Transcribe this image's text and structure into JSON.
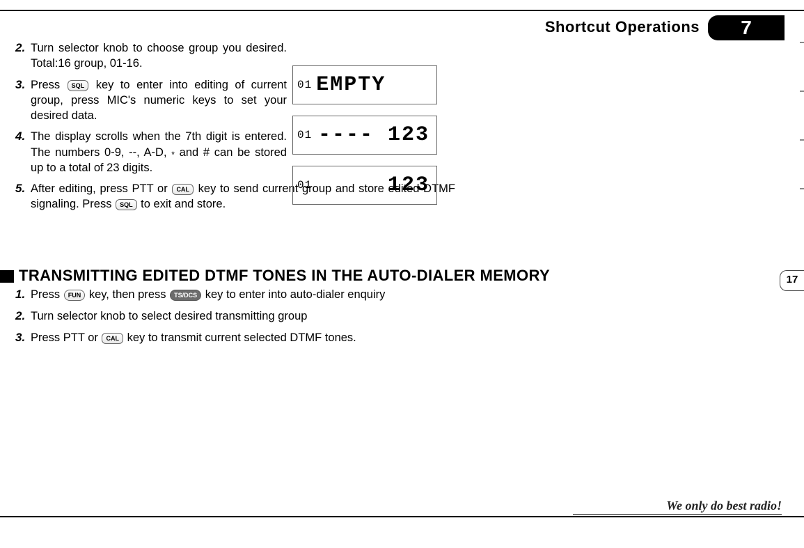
{
  "header": {
    "title": "Shortcut Operations",
    "chapter": "7"
  },
  "side_tab": "17",
  "tagline": "We only do best radio!",
  "keys": {
    "sql": "SQL",
    "cal": "CAL",
    "fun": "FUN",
    "tsdcs": "TS/DCS"
  },
  "steps_a": [
    {
      "n": "2.",
      "text": "Turn selector knob to choose group you desired. Total:16 group, 01-16."
    },
    {
      "n": "3.",
      "pre": "Press ",
      "key1": "sql",
      "post": "key to enter into editing of current group, press MIC's numeric keys to set your desired data."
    },
    {
      "n": "4.",
      "text": "The display scrolls when the 7th digit is entered. The numbers 0-9, --, A-D, ",
      "star": "*",
      "text2": " and # can be stored up to a total of 23 digits."
    },
    {
      "n": "5.",
      "pre": "After editing, press PTT or ",
      "key1": "cal",
      "mid": " key to send current group and store edited DTMF signaling. Press ",
      "key2": "sql",
      "post": " to exit and store."
    }
  ],
  "section_heading": "TRANSMITTING EDITED DTMF TONES IN THE AUTO-DIALER MEMORY",
  "steps_b": [
    {
      "n": "1.",
      "pre": "Press ",
      "key1": "fun",
      "mid": " key, then press ",
      "key2": "tsdcs",
      "post": " key to enter into auto-dialer enquiry"
    },
    {
      "n": "2.",
      "text": "Turn selector knob to select desired transmitting group"
    },
    {
      "n": "3.",
      "pre": "Press PTT or ",
      "key1": "cal",
      "post": " key to transmit current selected DTMF tones."
    }
  ],
  "lcd": [
    {
      "ch": "01",
      "val": "EMPTY"
    },
    {
      "ch": "01",
      "val": "---- 123"
    },
    {
      "ch": "01",
      "val": "123"
    }
  ]
}
